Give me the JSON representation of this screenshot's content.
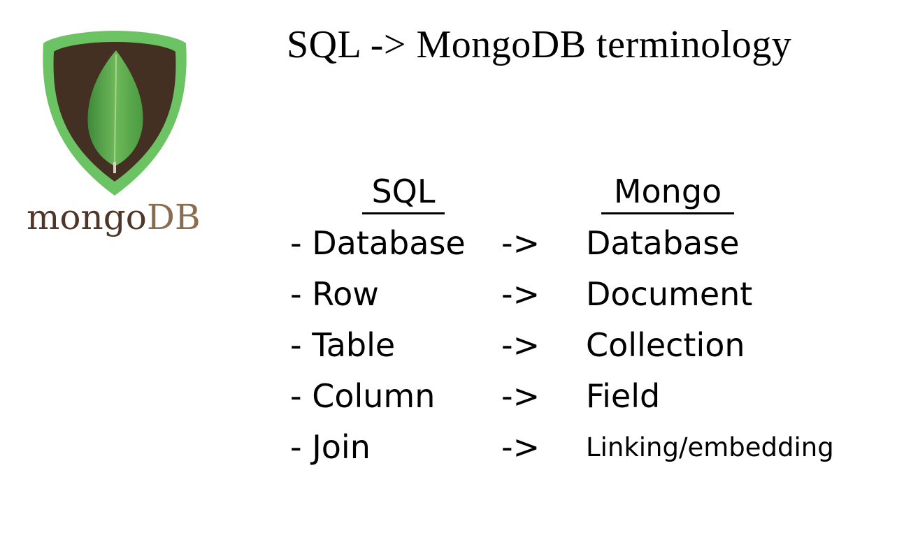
{
  "title": "SQL -> MongoDB terminology",
  "logo": {
    "word_mongo": "mongo",
    "word_db": "DB",
    "icon": "mongodb-leaf-icon",
    "colors": {
      "shield_outer": "#6cc363",
      "shield_inner": "#433022",
      "leaf": "#5ca449",
      "wordmark": "#4e3629"
    }
  },
  "headers": {
    "sql": "SQL",
    "mongo": "Mongo"
  },
  "rows": [
    {
      "sql": "- Database",
      "arrow": "->",
      "mongo": "Database"
    },
    {
      "sql": "- Row",
      "arrow": "->",
      "mongo": "Document"
    },
    {
      "sql": "- Table",
      "arrow": "->",
      "mongo": "Collection"
    },
    {
      "sql": "- Column",
      "arrow": "->",
      "mongo": "Field"
    },
    {
      "sql": "- Join",
      "arrow": "->",
      "mongo": "Linking/embedding"
    }
  ]
}
